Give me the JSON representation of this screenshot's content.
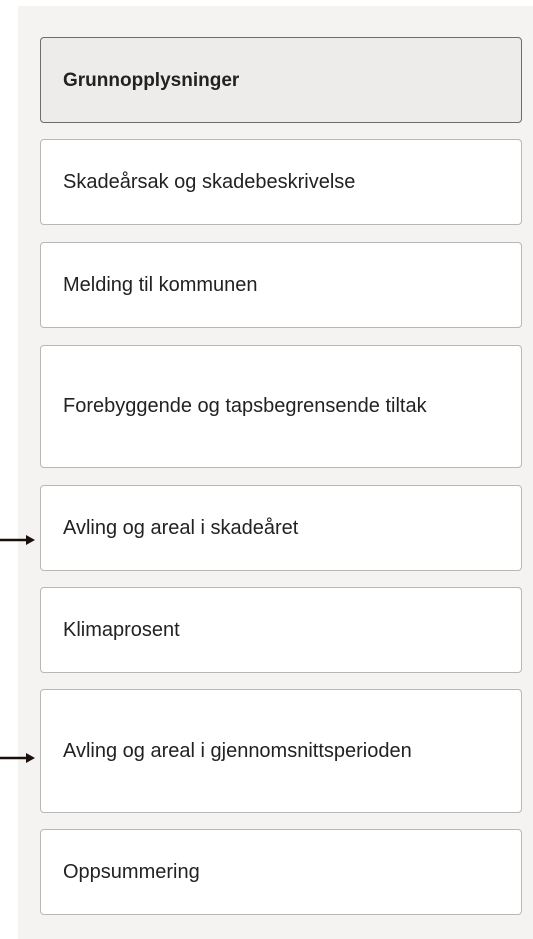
{
  "nav": {
    "items": [
      {
        "label": "Grunnopplysninger",
        "active": true
      },
      {
        "label": "Skadeårsak og skadebeskrivelse"
      },
      {
        "label": "Melding til kommunen"
      },
      {
        "label": "Forebyggende og tapsbegrensende tiltak"
      },
      {
        "label": "Avling og areal i skadeåret",
        "marked": true
      },
      {
        "label": "Klimaprosent"
      },
      {
        "label": "Avling og areal i gjennomsnittsperioden",
        "marked": true
      },
      {
        "label": "Oppsummering"
      }
    ]
  },
  "icons": {
    "marker": "arrow-right-icon"
  },
  "colors": {
    "panel_background": "#f4f3f2",
    "active_background": "#edeceb",
    "border": "#b9b6b3",
    "active_border": "#6f6c6a",
    "text": "#222222",
    "arrow": "#1a0f0a"
  }
}
